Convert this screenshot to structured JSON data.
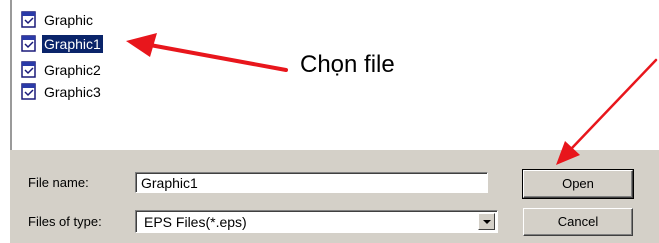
{
  "files": [
    {
      "name": "Graphic",
      "selected": false
    },
    {
      "name": "Graphic1",
      "selected": true
    },
    {
      "name": "Graphic2",
      "selected": false
    },
    {
      "name": "Graphic3",
      "selected": false
    }
  ],
  "form": {
    "file_name_label": "File name:",
    "file_name_value": "Graphic1",
    "file_type_label": "Files of type:",
    "file_type_value": "EPS Files(*.eps)"
  },
  "buttons": {
    "open": "Open",
    "cancel": "Cancel"
  },
  "annotation": {
    "label": "Chọn file",
    "arrow_color": "#e8161c"
  },
  "colors": {
    "selection": "#0a246a",
    "panel": "#d4d0c8"
  },
  "icons": {
    "file": "document-icon",
    "dropdown": "chevron-down-icon"
  }
}
